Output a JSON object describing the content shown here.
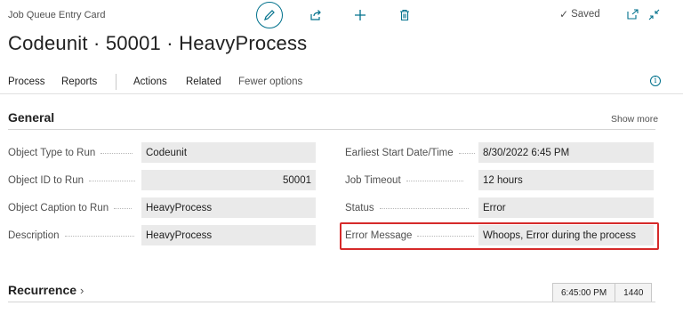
{
  "header": {
    "caption": "Job Queue Entry Card",
    "title": "Codeunit · 50001 · HeavyProcess",
    "saved_status": "Saved"
  },
  "toolbar": {
    "icons": [
      "pencil-icon",
      "share-icon",
      "plus-icon",
      "trash-icon"
    ],
    "right_icons": [
      "open-new-window-icon",
      "collapse-icon"
    ]
  },
  "actions": {
    "process": "Process",
    "reports": "Reports",
    "actions": "Actions",
    "related": "Related",
    "fewer_options": "Fewer options"
  },
  "general": {
    "title": "General",
    "show_more": "Show more",
    "left_fields": [
      {
        "label": "Object Type to Run",
        "value": "Codeunit"
      },
      {
        "label": "Object ID to Run",
        "value": "50001"
      },
      {
        "label": "Object Caption to Run",
        "value": "HeavyProcess"
      },
      {
        "label": "Description",
        "value": "HeavyProcess"
      }
    ],
    "right_fields": [
      {
        "label": "Earliest Start Date/Time",
        "value": "8/30/2022 6:45 PM"
      },
      {
        "label": "Job Timeout",
        "value": "12 hours"
      },
      {
        "label": "Status",
        "value": "Error"
      },
      {
        "label": "Error Message",
        "value": "Whoops, Error during the process"
      }
    ]
  },
  "recurrence": {
    "title": "Recurrence",
    "time": "6:45:00 PM",
    "minutes": "1440"
  },
  "colors": {
    "accent": "#00718c",
    "highlight": "#d62a2a",
    "field_bg": "#eaeaea"
  }
}
